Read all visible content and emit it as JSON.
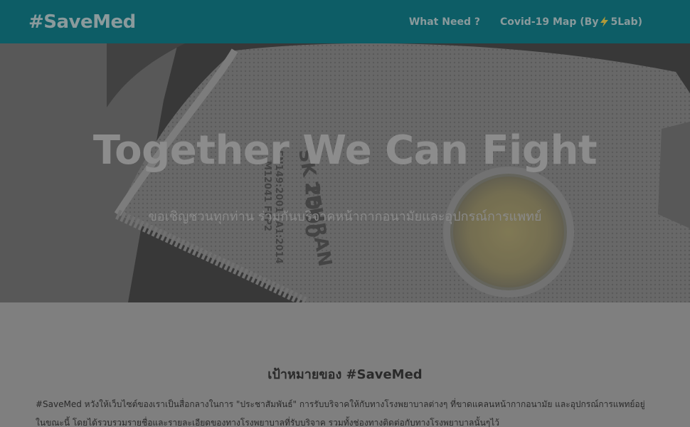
{
  "navbar": {
    "logo": "#SaveMed",
    "links": {
      "what_need": "What Need ?",
      "covid_map_prefix": "Covid-19 Map (By",
      "covid_map_suffix": "5Lab)"
    }
  },
  "hero": {
    "title": "Together We Can Fight",
    "subtitle": "ขอเชิญชวนทุกท่าน ร่วมกันบริจาคหน้ากากอนามัยและอุปกรณ์การแพทย์"
  },
  "content": {
    "section_title": "เป้าหมายของ #SaveMed",
    "paragraph": "#SaveMed หวังให้เว็บไซต์ของเราเป็นสื่อกลางในการ \"ประชาสัมพันธ์\" การรับบริจาคให้กับทางโรงพยาบาลต่างๆ ที่ขาดแคลนหน้ากากอนามัย และอุปกรณ์การแพทย์อยู่ในขณะนี้ โดยได้รวบรวมรายชื่อและรายละเอียดของทางโรงพยาบาลที่รับบริจาค รวมทั้งช่องทางติดต่อกับทางโรงพยาบาลนั้นๆไว้"
  },
  "colors": {
    "navbar_bg": "#0d5d66",
    "overlay": "#7f7f7f"
  }
}
